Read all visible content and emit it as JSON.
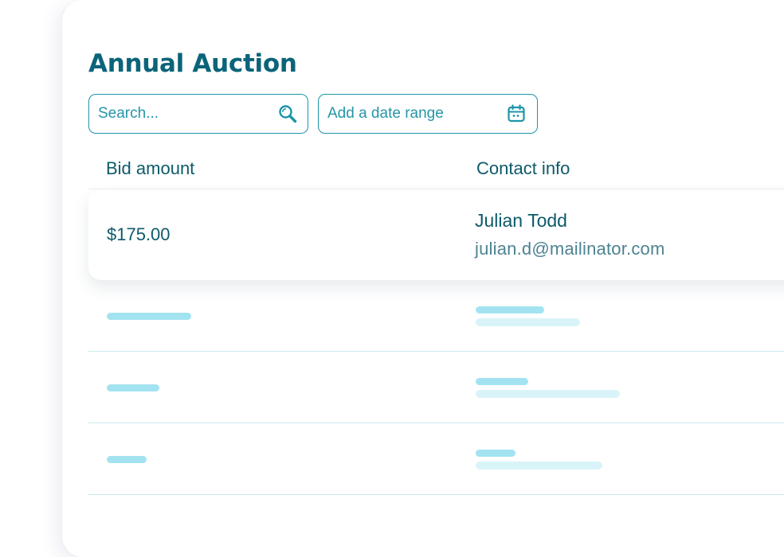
{
  "page": {
    "title": "Annual Auction"
  },
  "filters": {
    "search_placeholder": "Search...",
    "date_placeholder": "Add a date range",
    "search_icon": "search-icon",
    "date_icon": "calendar-icon"
  },
  "table": {
    "columns": [
      "Bid amount",
      "Contact info"
    ],
    "rows": [
      {
        "bid_amount": "$175.00",
        "contact_name": "Julian Todd",
        "contact_email": "julian.d@mailinator.com"
      }
    ],
    "placeholder_rows_count": 3
  },
  "colors": {
    "brand": "#0b6479",
    "accent": "#1b95a8",
    "skeleton": "#a3e3f1",
    "skeleton_light": "#d9f4f9"
  }
}
